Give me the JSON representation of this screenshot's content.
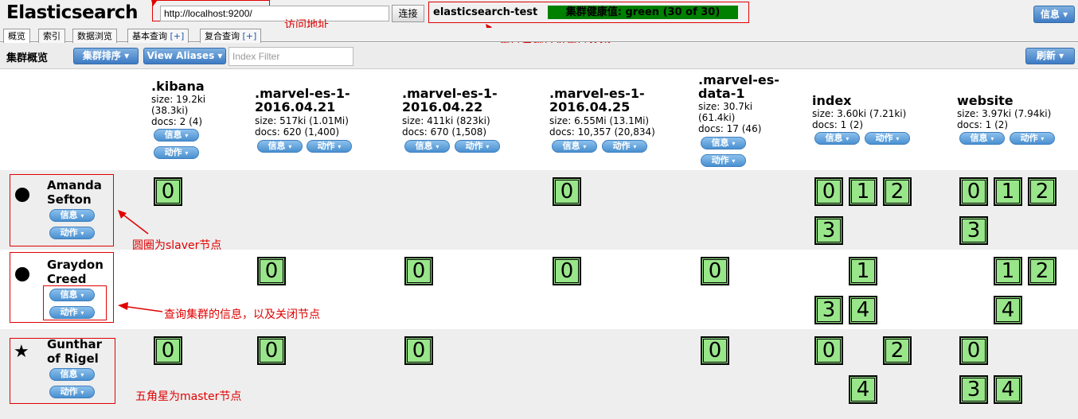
{
  "header": {
    "app_title": "Elasticsearch",
    "url_value": "http://localhost:9200/",
    "connect_label": "连接",
    "cluster_name": "elasticsearch-test",
    "cluster_health": "集群健康值: green (30 of 30)",
    "info_menu_label": "信息 ▾"
  },
  "tabs": [
    {
      "label": "概览"
    },
    {
      "label": "索引"
    },
    {
      "label": "数据浏览"
    },
    {
      "label": "基本查询",
      "plus": "[+]"
    },
    {
      "label": "复合查询",
      "plus": "[+]"
    }
  ],
  "toolbar": {
    "title": "集群概览",
    "sort_label": "集群排序 ▾",
    "aliases_label": "View Aliases ▾",
    "filter_placeholder": "Index Filter",
    "refresh_label": "刷新 ▾"
  },
  "buttons": {
    "info": "信息",
    "action": "动作",
    "caret": "▾"
  },
  "indices": [
    {
      "name": ".kibana",
      "size": "size: 19.2ki",
      "size2": "(38.3ki)",
      "docs": "docs: 2 (4)"
    },
    {
      "name_l1": ".marvel-es-1-",
      "name_l2": "2016.04.21",
      "size": "size: 517ki (1.01Mi)",
      "docs": "docs: 620 (1,400)"
    },
    {
      "name_l1": ".marvel-es-1-",
      "name_l2": "2016.04.22",
      "size": "size: 411ki (823ki)",
      "docs": "docs: 670 (1,508)"
    },
    {
      "name_l1": ".marvel-es-1-",
      "name_l2": "2016.04.25",
      "size": "size: 6.55Mi (13.1Mi)",
      "docs": "docs: 10,357 (20,834)"
    },
    {
      "name_l1": ".marvel-es-",
      "name_l2": "data-1",
      "size": "size: 30.7ki",
      "size2": "(61.4ki)",
      "docs": "docs: 17 (46)"
    },
    {
      "name": "index",
      "size": "size: 3.60ki (7.21ki)",
      "docs": "docs: 1 (2)"
    },
    {
      "name": "website",
      "size": "size: 3.97ki (7.94ki)",
      "docs": "docs: 1 (2)"
    }
  ],
  "nodes": [
    {
      "name_l1": "Amanda",
      "name_l2": "Sefton",
      "role": "slave"
    },
    {
      "name_l1": "Graydon",
      "name_l2": "Creed",
      "role": "slave"
    },
    {
      "name_l1": "Gunthar",
      "name_l2": "of Rigel",
      "role": "master"
    }
  ],
  "shards": {
    "node0": [
      {
        "col": 0,
        "v": "0"
      },
      {
        "col": 3,
        "v": "0"
      },
      {
        "col": 5,
        "v": "0"
      },
      {
        "col": 5,
        "v": "1"
      },
      {
        "col": 5,
        "v": "2"
      },
      {
        "col": 5,
        "v": "3"
      },
      {
        "col": 6,
        "v": "0"
      },
      {
        "col": 6,
        "v": "1"
      },
      {
        "col": 6,
        "v": "2"
      },
      {
        "col": 6,
        "v": "3"
      }
    ],
    "node1": [
      {
        "col": 1,
        "v": "0"
      },
      {
        "col": 2,
        "v": "0"
      },
      {
        "col": 3,
        "v": "0"
      },
      {
        "col": 4,
        "v": "0"
      },
      {
        "col": 5,
        "v": "1"
      },
      {
        "col": 5,
        "v": "3"
      },
      {
        "col": 5,
        "v": "4"
      },
      {
        "col": 6,
        "v": "1"
      },
      {
        "col": 6,
        "v": "2"
      },
      {
        "col": 6,
        "v": "4"
      }
    ],
    "node2": [
      {
        "col": 0,
        "v": "0"
      },
      {
        "col": 1,
        "v": "0"
      },
      {
        "col": 2,
        "v": "0"
      },
      {
        "col": 4,
        "v": "0"
      },
      {
        "col": 5,
        "v": "0"
      },
      {
        "col": 5,
        "v": "2"
      },
      {
        "col": 5,
        "v": "4"
      },
      {
        "col": 6,
        "v": "0"
      },
      {
        "col": 6,
        "v": "3"
      },
      {
        "col": 6,
        "v": "4"
      }
    ]
  },
  "annotations": {
    "url": "访问地址",
    "cluster": "集群名称以及集群状态",
    "slave": "圆圈为slaver节点",
    "query": "查询集群的信息，以及关闭节点",
    "master": "五角星为master节点"
  },
  "colors": {
    "health": "#008000",
    "shard": "#99e68a",
    "annotation": "#e00000",
    "row_alt": "#eeeeee"
  }
}
